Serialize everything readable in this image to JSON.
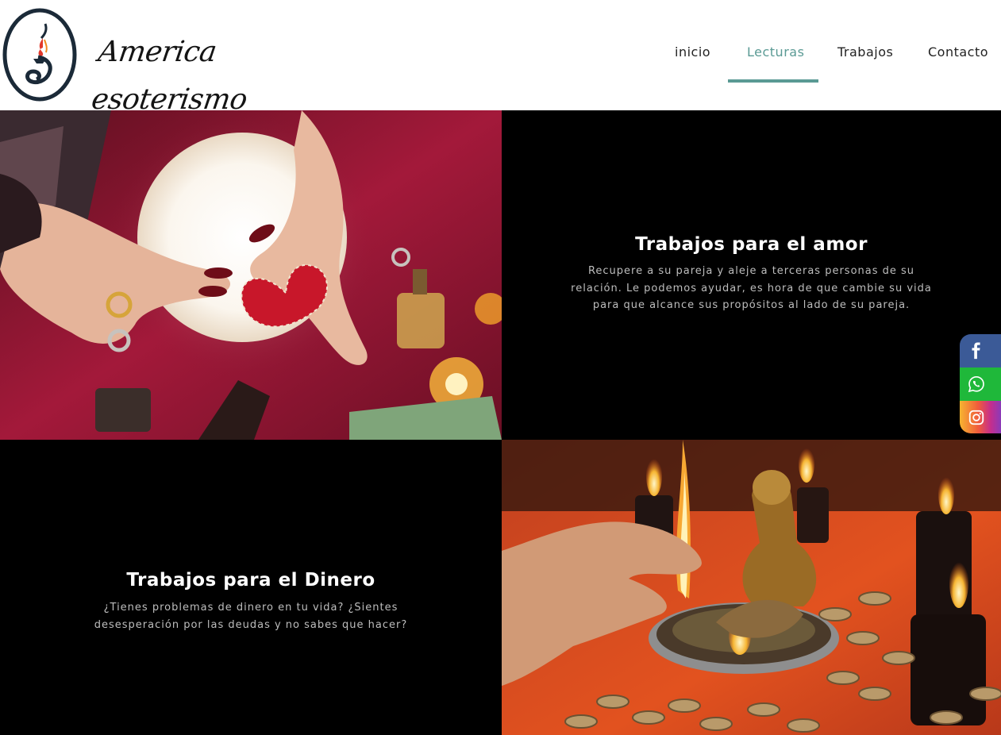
{
  "brand": {
    "name": "America esoterismo"
  },
  "nav": {
    "items": [
      {
        "label": "inicio",
        "active": false
      },
      {
        "label": "Lecturas",
        "active": true
      },
      {
        "label": "Trabajos",
        "active": false
      },
      {
        "label": "Contacto",
        "active": false
      }
    ]
  },
  "sections": [
    {
      "heading": "Trabajos para el amor",
      "body": "Recupere a su pareja y aleje a terceras personas de su relación. Le podemos ayudar, es hora de que cambie su vida para que alcance sus propósitos al lado de su pareja."
    },
    {
      "heading": "Trabajos para el Dinero",
      "body": "¿Tienes problemas de dinero en tu vida? ¿Sientes desesperación por las deudas y no sabes que hacer?"
    }
  ],
  "social": {
    "items": [
      {
        "icon": "facebook-icon"
      },
      {
        "icon": "whatsapp-icon"
      },
      {
        "icon": "instagram-icon"
      }
    ]
  },
  "colors": {
    "accent": "#5a9a94",
    "facebook": "#3b5a97",
    "whatsapp": "#1fb83a",
    "background": "#000000",
    "header": "#ffffff"
  }
}
